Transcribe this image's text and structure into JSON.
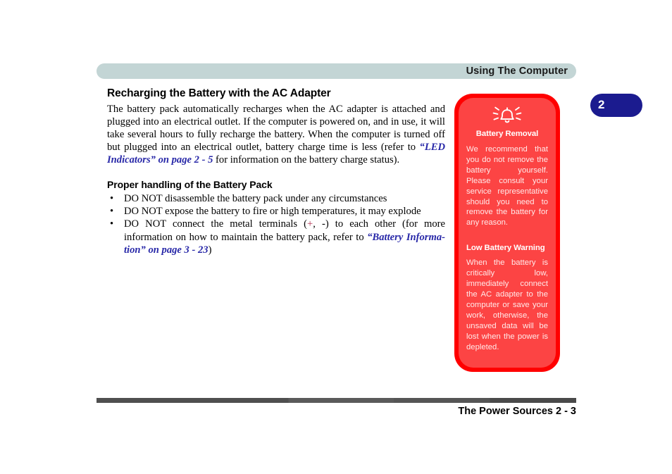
{
  "header": {
    "running_title": "Using The Computer"
  },
  "chapter_tab": {
    "number": "2"
  },
  "main": {
    "section_title": "Recharging the Battery with the AC Adapter",
    "intro_paragraph": {
      "part1": "The battery pack automatically recharges when the AC adapter is attached and plugged into an electrical outlet. If the computer is powered on, and in use, it will take several hours to fully recharge the battery. When the computer is turned off but plugged into an electrical outlet, battery charge time is less (refer to ",
      "xref": "“LED Indicators” on page 2 - 5",
      "part2": " for information on the battery charge status)."
    },
    "sub_title": "Proper handling of the Battery Pack",
    "bullet_marker": "•",
    "bullets": [
      {
        "text": "DO NOT disassemble the battery pack under any circumstances"
      },
      {
        "text": "DO NOT expose the battery to fire or high temperatures, it may explode"
      },
      {
        "prefix": "DO NOT connect the metal terminals (",
        "plus": "+",
        "middle": ", -) to each other (for more information on how to maintain the battery pack, refer to ",
        "xref": "“Battery Informa-tion” on page 3 - 23",
        "suffix": ")"
      }
    ]
  },
  "warning_sidebar": {
    "icon_name": "alarm-bell-icon",
    "sections": [
      {
        "heading": "Battery Removal",
        "body": "We recommend that you do not remove the battery yourself. Please consult your service representative should you need to remove the battery for any reason."
      },
      {
        "heading": "Low Battery Warning",
        "body": "When the battery is critically low, immediately connect the AC adapter to the computer or save your work, otherwise, the unsaved data will be lost when the power is depleted."
      }
    ]
  },
  "footer": {
    "text": "The Power Sources  2  -  3"
  },
  "colors": {
    "header_bar": "#c3d5d5",
    "chapter_tab": "#1b1b8f",
    "warning_border": "#ff0000",
    "warning_fill": "#fc4444",
    "xref_link": "#2828a8",
    "footer_rule": "#4f4f4f"
  }
}
